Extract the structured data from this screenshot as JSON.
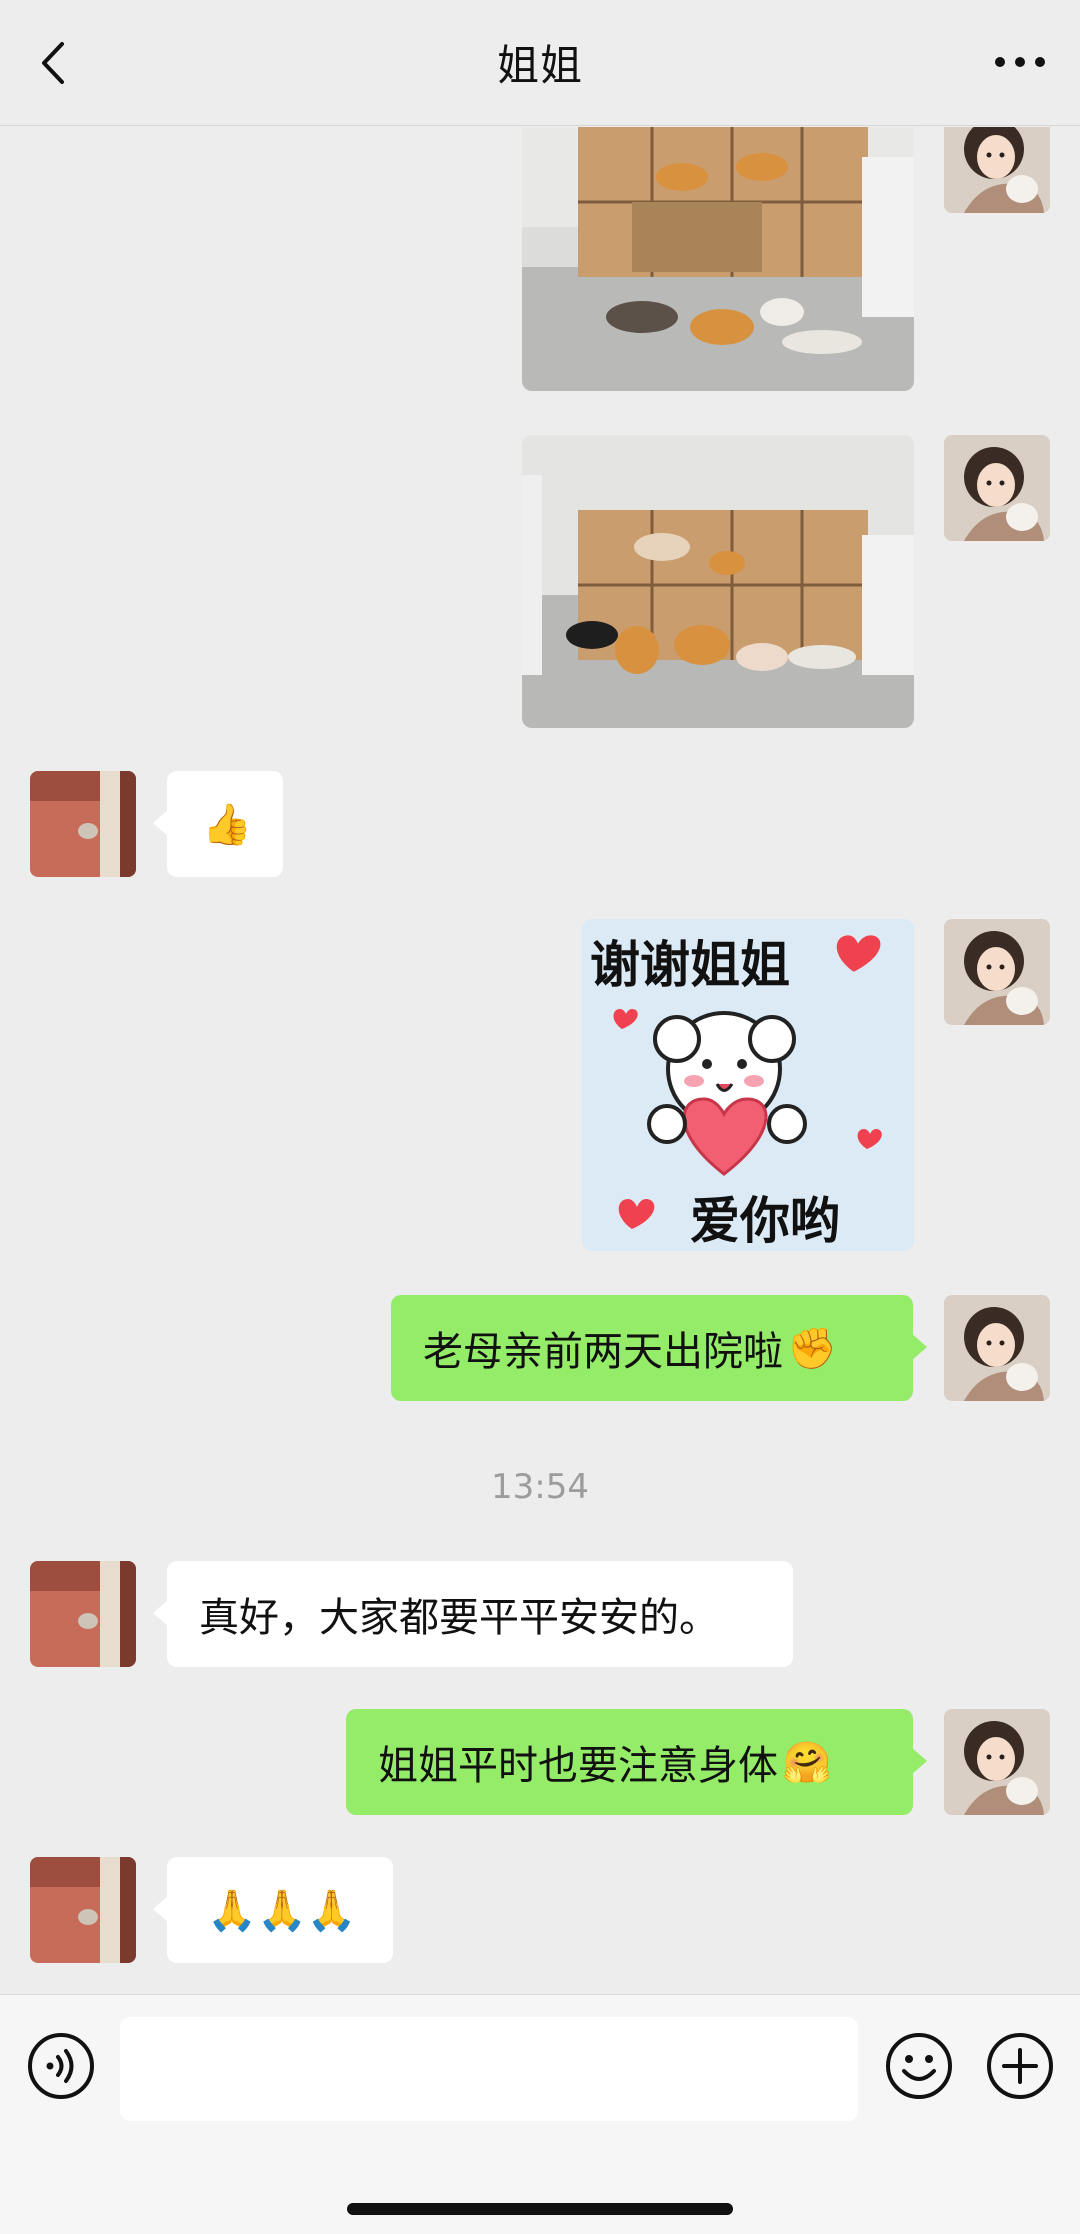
{
  "header": {
    "title": "姐姐",
    "back_icon": "chevron-left-icon",
    "more_icon": "more-dots-icon"
  },
  "messages": [
    {
      "from": "me",
      "type": "image",
      "description_icon": "cats-photo"
    },
    {
      "from": "me",
      "type": "image",
      "description_icon": "cats-photo"
    },
    {
      "from": "them",
      "type": "text",
      "emoji": "👍"
    },
    {
      "from": "me",
      "type": "sticker",
      "top_text": "谢谢姐姐",
      "bottom_text": "爱你哟"
    },
    {
      "from": "me",
      "type": "text",
      "text": "老母亲前两天出院啦",
      "emoji": "✊"
    },
    {
      "from": "them",
      "type": "text",
      "text": "真好，大家都要平平安安的。"
    },
    {
      "from": "me",
      "type": "text",
      "text": "姐姐平时也要注意身体",
      "emoji": "🤗"
    },
    {
      "from": "them",
      "type": "text",
      "emoji": "🙏🙏🙏"
    }
  ],
  "timestamp": "13:54",
  "input": {
    "placeholder": "",
    "value": ""
  },
  "colors": {
    "background": "#EDEDED",
    "my_bubble": "#95EC69",
    "their_bubble": "#FFFFFF",
    "timestamp": "#9C9C9C"
  }
}
